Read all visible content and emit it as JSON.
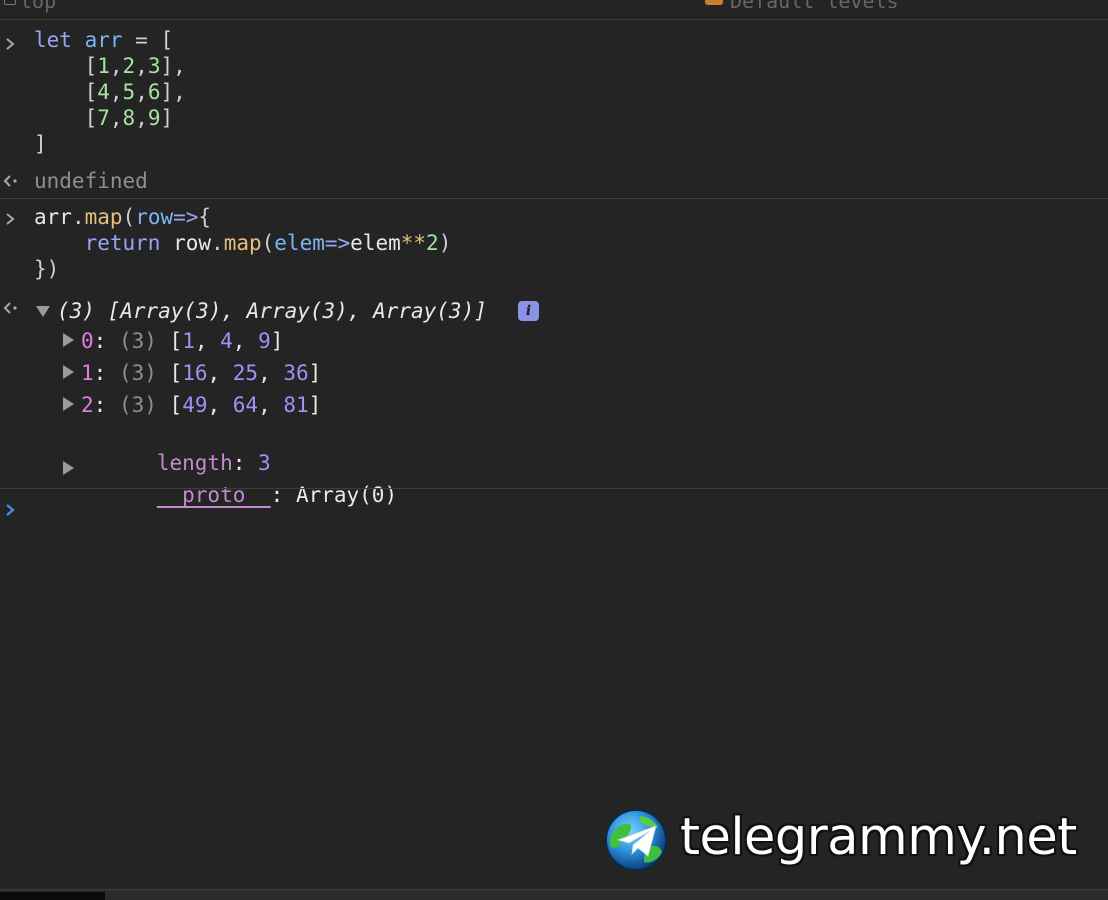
{
  "header": {
    "left_fragment": "top",
    "right_fragment": "Default levels"
  },
  "entries": [
    {
      "kind": "input",
      "lines": [
        [
          {
            "t": "let",
            "c": "kw2"
          },
          {
            "t": " ",
            "c": "pl"
          },
          {
            "t": "arr",
            "c": "var"
          },
          {
            "t": " = [",
            "c": "op"
          }
        ],
        [
          {
            "t": "    [",
            "c": "op"
          },
          {
            "t": "1",
            "c": "num"
          },
          {
            "t": ",",
            "c": "op"
          },
          {
            "t": "2",
            "c": "num"
          },
          {
            "t": ",",
            "c": "op"
          },
          {
            "t": "3",
            "c": "num"
          },
          {
            "t": "],",
            "c": "op"
          }
        ],
        [
          {
            "t": "    [",
            "c": "op"
          },
          {
            "t": "4",
            "c": "num"
          },
          {
            "t": ",",
            "c": "op"
          },
          {
            "t": "5",
            "c": "num"
          },
          {
            "t": ",",
            "c": "op"
          },
          {
            "t": "6",
            "c": "num"
          },
          {
            "t": "],",
            "c": "op"
          }
        ],
        [
          {
            "t": "    [",
            "c": "op"
          },
          {
            "t": "7",
            "c": "num"
          },
          {
            "t": ",",
            "c": "op"
          },
          {
            "t": "8",
            "c": "num"
          },
          {
            "t": ",",
            "c": "op"
          },
          {
            "t": "9",
            "c": "num"
          },
          {
            "t": "]",
            "c": "op"
          }
        ],
        [
          {
            "t": "]",
            "c": "op"
          }
        ]
      ]
    },
    {
      "kind": "result",
      "text": "undefined"
    },
    {
      "kind": "input",
      "lines": [
        [
          {
            "t": "arr",
            "c": "pl"
          },
          {
            "t": ".",
            "c": "op"
          },
          {
            "t": "map",
            "c": "fn"
          },
          {
            "t": "(",
            "c": "op"
          },
          {
            "t": "row",
            "c": "var"
          },
          {
            "t": "=>",
            "c": "kw2"
          },
          {
            "t": "{",
            "c": "op"
          }
        ],
        [
          {
            "t": "    ",
            "c": "pl"
          },
          {
            "t": "return",
            "c": "kw2"
          },
          {
            "t": " ",
            "c": "pl"
          },
          {
            "t": "row",
            "c": "pl"
          },
          {
            "t": ".",
            "c": "op"
          },
          {
            "t": "map",
            "c": "fn"
          },
          {
            "t": "(",
            "c": "op"
          },
          {
            "t": "elem",
            "c": "var"
          },
          {
            "t": "=>",
            "c": "kw2"
          },
          {
            "t": "elem",
            "c": "pl"
          },
          {
            "t": "**",
            "c": "fn"
          },
          {
            "t": "2",
            "c": "num"
          },
          {
            "t": ")",
            "c": "op"
          }
        ],
        [
          {
            "t": "})",
            "c": "op"
          }
        ]
      ]
    }
  ],
  "result_array": {
    "summary": "(3) [Array(3), Array(3), Array(3)]",
    "info_badge": "i",
    "items": [
      {
        "index": "0",
        "count": "(3)",
        "values": [
          "1",
          "4",
          "9"
        ]
      },
      {
        "index": "1",
        "count": "(3)",
        "values": [
          "16",
          "25",
          "36"
        ]
      },
      {
        "index": "2",
        "count": "(3)",
        "values": [
          "49",
          "64",
          "81"
        ]
      }
    ],
    "length_key": "length",
    "length_value": "3",
    "proto_key": "__proto__",
    "proto_value": "Array(0)"
  },
  "prompt": {
    "value": ""
  },
  "watermark": {
    "text": "telegrammy.net"
  },
  "colors": {
    "background": "#242424",
    "separator": "#3d3d3d",
    "prompt_blue": "#4a8ff0",
    "number_purple": "#9f91f6",
    "index_magenta": "#e07ce2"
  }
}
